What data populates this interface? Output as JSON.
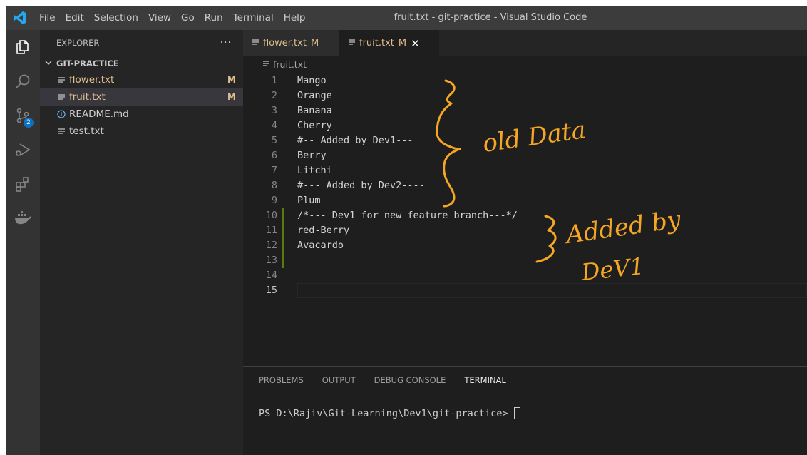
{
  "titlebar": {
    "menu": [
      "File",
      "Edit",
      "Selection",
      "View",
      "Go",
      "Run",
      "Terminal",
      "Help"
    ],
    "window_title": "fruit.txt - git-practice - Visual Studio Code"
  },
  "activity_bar": {
    "items": [
      "explorer-icon",
      "search-icon",
      "source-control-icon",
      "run-debug-icon",
      "extensions-icon",
      "docker-icon"
    ],
    "source_control_badge": "2"
  },
  "sidebar": {
    "title": "EXPLORER",
    "more": "···",
    "folder": "GIT-PRACTICE",
    "files": [
      {
        "name": "flower.txt",
        "status": "M",
        "icon": "file-lines-icon"
      },
      {
        "name": "fruit.txt",
        "status": "M",
        "icon": "file-lines-icon"
      },
      {
        "name": "README.md",
        "status": "",
        "icon": "info-icon"
      },
      {
        "name": "test.txt",
        "status": "",
        "icon": "file-lines-icon"
      }
    ]
  },
  "tabs": [
    {
      "name": "flower.txt",
      "status": "M"
    },
    {
      "name": "fruit.txt",
      "status": "M",
      "close": "✕"
    }
  ],
  "breadcrumb": "fruit.txt",
  "editor": {
    "lines": [
      {
        "num": "1",
        "text": "Mango"
      },
      {
        "num": "2",
        "text": "Orange"
      },
      {
        "num": "3",
        "text": "Banana"
      },
      {
        "num": "4",
        "text": "Cherry"
      },
      {
        "num": "5",
        "text": "#-- Added by Dev1---"
      },
      {
        "num": "6",
        "text": "Berry"
      },
      {
        "num": "7",
        "text": "Litchi"
      },
      {
        "num": "8",
        "text": "#--- Added by Dev2----"
      },
      {
        "num": "9",
        "text": "Plum"
      },
      {
        "num": "10",
        "text": "/*--- Dev1 for new feature branch---*/"
      },
      {
        "num": "11",
        "text": "red-Berry"
      },
      {
        "num": "12",
        "text": "Avacardo"
      },
      {
        "num": "13",
        "text": ""
      },
      {
        "num": "14",
        "text": ""
      },
      {
        "num": "15",
        "text": ""
      }
    ],
    "added_lines": [
      "10",
      "11",
      "12",
      "13"
    ],
    "current_line": "15"
  },
  "annotations": {
    "old_data": "old Data",
    "added_by": "Added by",
    "dev1": "DeV1",
    "color": "#f5a623"
  },
  "panel": {
    "tabs": [
      "PROBLEMS",
      "OUTPUT",
      "DEBUG CONSOLE",
      "TERMINAL"
    ],
    "active_tab": "TERMINAL",
    "prompt": "PS D:\\Rajiv\\Git-Learning\\Dev1\\git-practice>"
  }
}
